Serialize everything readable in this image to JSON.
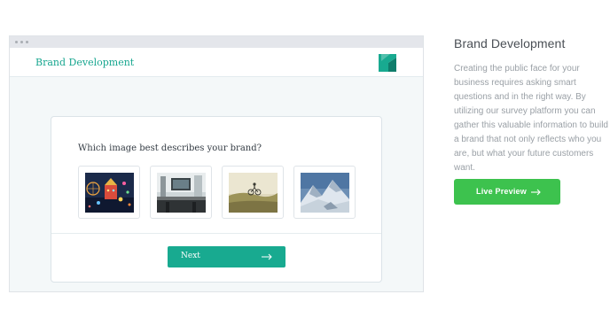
{
  "browser": {
    "app_title": "Brand Development",
    "logo_icon": "brand-logo-icon"
  },
  "survey": {
    "question": "Which image best describes your brand?",
    "choices": [
      {
        "icon": "carnival-night-image"
      },
      {
        "icon": "workspace-desk-image"
      },
      {
        "icon": "cyclist-field-image"
      },
      {
        "icon": "snowy-mountain-image"
      }
    ],
    "next_label": "Next"
  },
  "side_panel": {
    "title": "Brand Development",
    "description": "Creating the public face for your business requires asking smart questions and in the right way. By utilizing our survey platform you can gather this valuable information to build a brand that not only reflects who you are, but what your future customers want.",
    "button_label": "Live Preview"
  },
  "colors": {
    "accent_teal": "#18aa90",
    "preview_green": "#3dc24e",
    "title_teal": "#17a68f"
  }
}
